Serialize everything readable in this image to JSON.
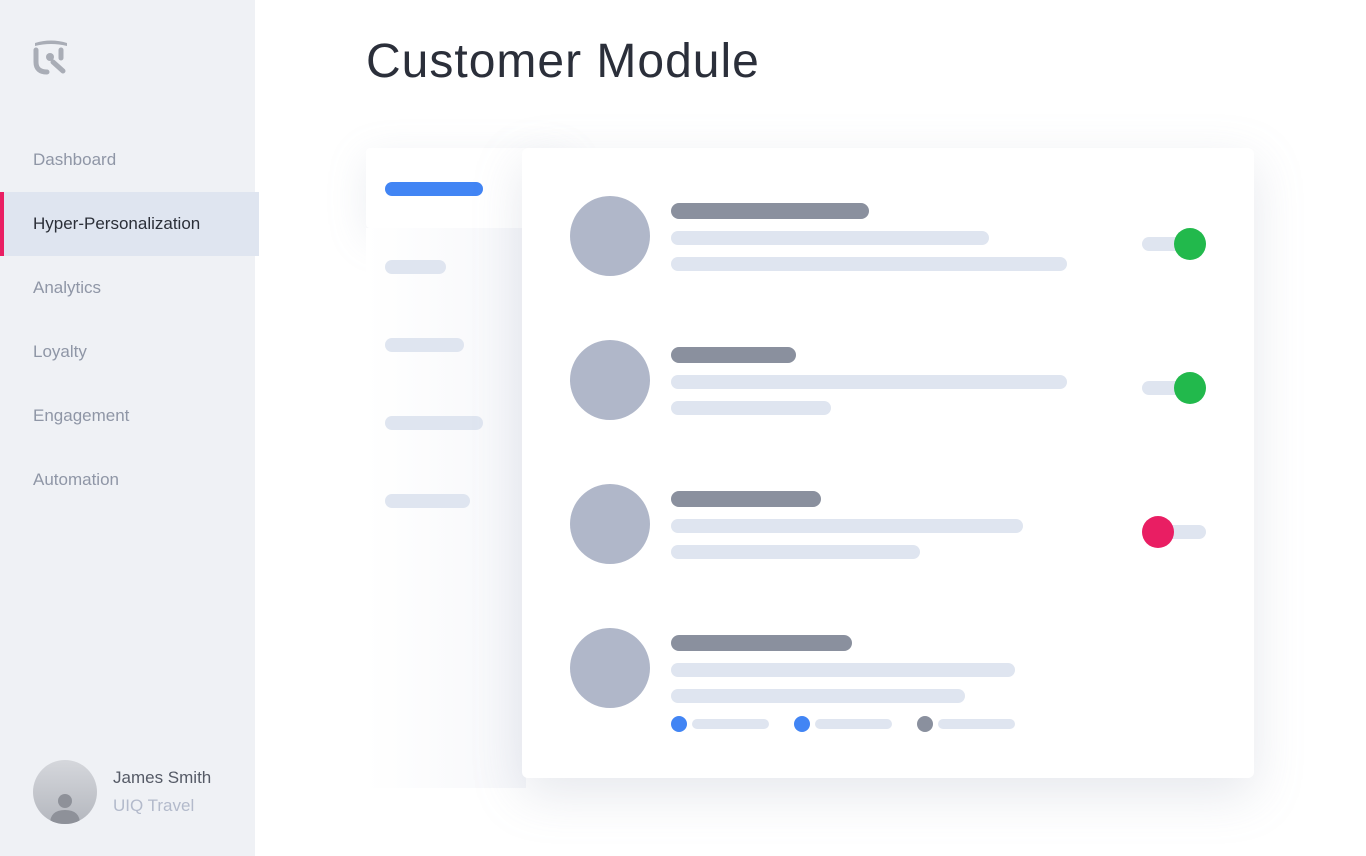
{
  "sidebar": {
    "logo_icon": "uiq-logo-icon",
    "nav": [
      {
        "label": "Dashboard",
        "active": false
      },
      {
        "label": "Hyper-Personalization",
        "active": true
      },
      {
        "label": "Analytics",
        "active": false
      },
      {
        "label": "Loyalty",
        "active": false
      },
      {
        "label": "Engagement",
        "active": false
      },
      {
        "label": "Automation",
        "active": false
      }
    ],
    "user": {
      "name": "James Smith",
      "organization": "UIQ Travel",
      "avatar_icon": "user-silhouette-icon"
    }
  },
  "main": {
    "title": "Customer Module"
  },
  "colors": {
    "accent_blue": "#4285f4",
    "active_indicator": "#e91e63",
    "toggle_on": "#22b94c",
    "toggle_off": "#e91e63",
    "placeholder_dark": "#8a909e",
    "placeholder_light": "#dfe5f0",
    "avatar_placeholder": "#b0b7c9"
  },
  "customer_list": [
    {
      "toggle": "on",
      "tags": []
    },
    {
      "toggle": "on",
      "tags": []
    },
    {
      "toggle": "off",
      "tags": []
    },
    {
      "toggle": null,
      "tags": [
        {
          "color": "#4285f4"
        },
        {
          "color": "#4285f4"
        },
        {
          "color": "#8a909e"
        }
      ]
    }
  ]
}
